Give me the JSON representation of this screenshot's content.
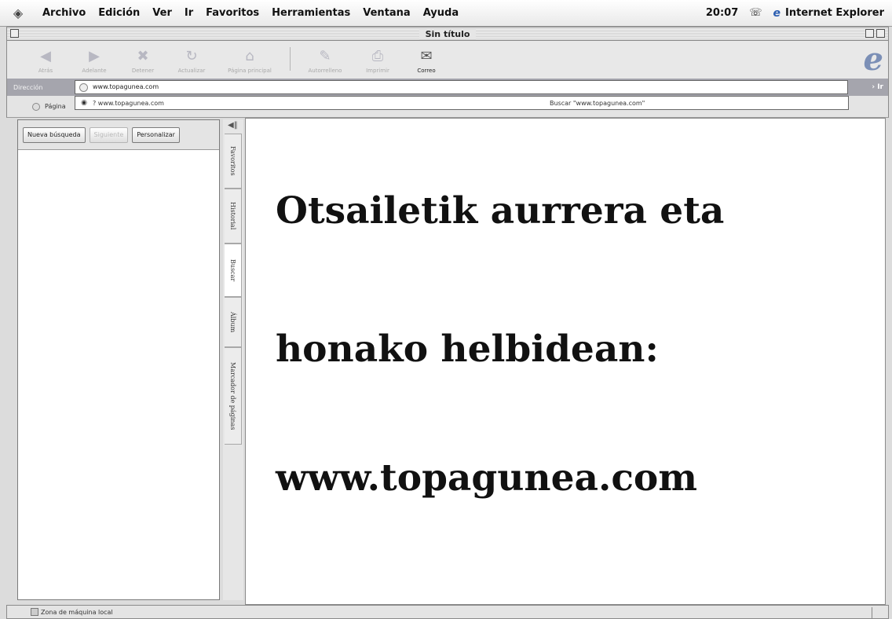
{
  "menubar": {
    "apple_icon": "apple-icon",
    "items": [
      "Archivo",
      "Edición",
      "Ver",
      "Ir",
      "Favoritos",
      "Herramientas",
      "Ventana",
      "Ayuda"
    ],
    "clock": "20:07",
    "app_name": "Internet Explorer"
  },
  "window": {
    "title": "Sin título"
  },
  "toolbar": {
    "buttons": [
      {
        "label": "Atrás",
        "icon": "back-arrow-icon",
        "enabled": false
      },
      {
        "label": "Adelante",
        "icon": "forward-arrow-icon",
        "enabled": false
      },
      {
        "label": "Detener",
        "icon": "stop-icon",
        "enabled": false
      },
      {
        "label": "Actualizar",
        "icon": "refresh-icon",
        "enabled": false
      },
      {
        "label": "Página principal",
        "icon": "home-icon",
        "enabled": false
      },
      {
        "label": "Autorrelleno",
        "icon": "autofill-icon",
        "enabled": false
      },
      {
        "label": "Imprimir",
        "icon": "print-icon",
        "enabled": false
      },
      {
        "label": "Correo",
        "icon": "mail-icon",
        "enabled": true
      }
    ]
  },
  "address": {
    "label": "Dirección",
    "value": "www.topagunea.com",
    "go_label": "Ir"
  },
  "autocomplete": {
    "suggestion": "? www.topagunea.com",
    "search_suggestion": "Buscar \"www.topagunea.com\""
  },
  "linksbar": {
    "item": "Página"
  },
  "explorer": {
    "buttons": {
      "new_search": "Nueva búsqueda",
      "next": "Siguiente",
      "customize": "Personalizar"
    },
    "tabs": [
      "Favoritos",
      "Historial",
      "Buscar",
      "Álbum",
      "Marcador de páginas"
    ]
  },
  "content": {
    "lines": [
      "Otsailetik aurrera eta",
      "honako helbidean:",
      "www.topagunea.com"
    ]
  },
  "statusbar": {
    "zone": "Zona de máquina local"
  }
}
